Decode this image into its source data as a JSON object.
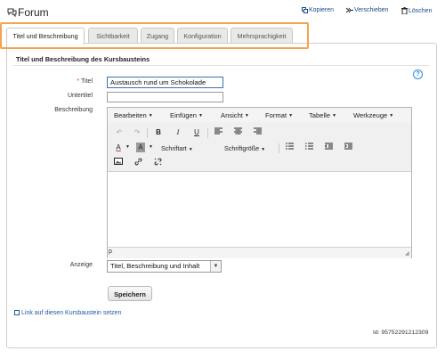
{
  "header": {
    "title": "Forum",
    "actions": [
      {
        "label": "Kopieren",
        "icon": "copy-icon"
      },
      {
        "label": "Verschieben",
        "icon": "move-icon"
      },
      {
        "label": "Löschen",
        "icon": "trash-icon"
      }
    ]
  },
  "tabs": [
    {
      "label": "Titel und Beschreibung",
      "active": true
    },
    {
      "label": "Sichtbarkeit",
      "active": false
    },
    {
      "label": "Zugang",
      "active": false
    },
    {
      "label": "Konfiguration",
      "active": false
    },
    {
      "label": "Mehrsprachigkeit",
      "active": false
    }
  ],
  "form": {
    "section_title": "Titel und Beschreibung des Kursbausteins",
    "title_label": "Titel",
    "title_required_mark": "*",
    "title_value": "Austausch rund um Schokolade",
    "subtitle_label": "Untertitel",
    "subtitle_value": "",
    "description_label": "Beschreibung",
    "display_label": "Anzeige",
    "display_value": "Titel, Beschreibung und Inhalt",
    "save_label": "Speichern",
    "link_label": "Link auf diesen Kursbaustein setzen",
    "id_text": "Id: 95752291212309"
  },
  "editor": {
    "menu": [
      "Bearbeiten",
      "Einfügen",
      "Ansicht",
      "Format",
      "Tabelle",
      "Werkzeuge"
    ],
    "font_family_label": "Schriftart",
    "font_size_label": "Schriftgröße",
    "status_path": "p"
  },
  "colors": {
    "highlight": "#f6a24e",
    "link": "#1f5aa6",
    "help": "#2a8fd6"
  }
}
